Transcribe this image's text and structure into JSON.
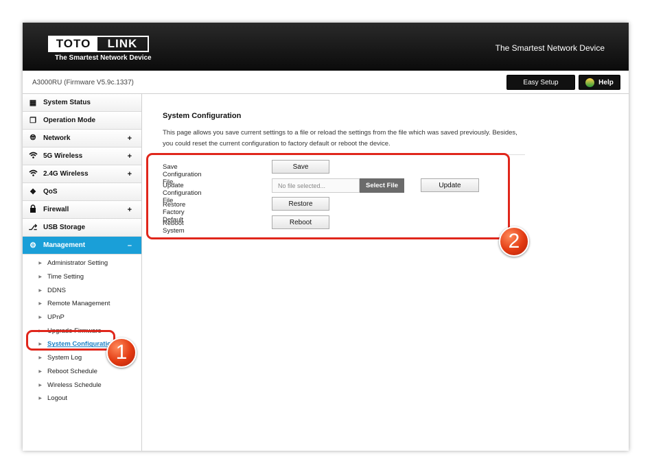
{
  "header": {
    "logo_left": "TOTO",
    "logo_right": "LINK",
    "logo_subtitle": "The Smartest Network Device",
    "tagline": "The Smartest Network Device"
  },
  "subbar": {
    "model": "A3000RU (Firmware V5.9c.1337)",
    "easy_setup": "Easy Setup",
    "help": "Help"
  },
  "sidebar": {
    "items": [
      {
        "label": "System Status",
        "icon": "chat-icon",
        "plus": ""
      },
      {
        "label": "Operation Mode",
        "icon": "windows-icon",
        "plus": ""
      },
      {
        "label": "Network",
        "icon": "globe-icon",
        "plus": "+"
      },
      {
        "label": "5G Wireless",
        "icon": "wifi-icon",
        "plus": "+"
      },
      {
        "label": "2.4G Wireless",
        "icon": "wifi-icon",
        "plus": "+"
      },
      {
        "label": "QoS",
        "icon": "qos-icon",
        "plus": ""
      },
      {
        "label": "Firewall",
        "icon": "lock-icon",
        "plus": "+"
      },
      {
        "label": "USB Storage",
        "icon": "usb-icon",
        "plus": ""
      },
      {
        "label": "Management",
        "icon": "gear-icon",
        "plus": "–"
      }
    ],
    "sub_items": [
      "Administrator Setting",
      "Time Setting",
      "DDNS",
      "Remote Management",
      "UPnP",
      "Upgrade Firmware",
      "System Configuration",
      "System Log",
      "Reboot Schedule",
      "Wireless Schedule",
      "Logout"
    ]
  },
  "main": {
    "title": "System Configuration",
    "description": "This page allows you save current settings to a file or reload the settings from the file which was saved previously. Besides, you could reset the current configuration to factory default or reboot the device.",
    "rows": {
      "save_label": "Save Configuration File",
      "save_button": "Save",
      "update_label": "Update Configuration File",
      "file_placeholder": "No file selected...",
      "select_file": "Select File",
      "update_button": "Update",
      "restore_label": "Restore Factory Default",
      "restore_button": "Restore",
      "reboot_label": "Reboot System",
      "reboot_button": "Reboot"
    }
  },
  "annotations": {
    "badge1": "1",
    "badge2": "2",
    "color": "#e0261b"
  }
}
